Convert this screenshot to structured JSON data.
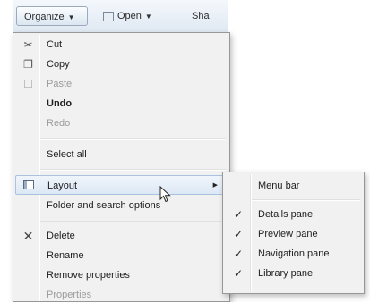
{
  "toolbar": {
    "organize_label": "Organize",
    "open_label": "Open",
    "share_label": "Sha"
  },
  "menu": {
    "items": [
      {
        "label": "Cut",
        "icon": "scissors-icon",
        "state": "enabled"
      },
      {
        "label": "Copy",
        "icon": "copy-icon",
        "state": "enabled"
      },
      {
        "label": "Paste",
        "icon": "paste-icon",
        "state": "disabled"
      },
      {
        "label": "Undo",
        "state": "bold"
      },
      {
        "label": "Redo",
        "state": "disabled"
      },
      {
        "label": "Select all",
        "state": "enabled"
      },
      {
        "label": "Layout",
        "icon": "layout-icon",
        "state": "highlighted",
        "submenu": true
      },
      {
        "label": "Folder and search options",
        "state": "enabled"
      },
      {
        "label": "Delete",
        "icon": "delete-icon",
        "state": "enabled"
      },
      {
        "label": "Rename",
        "state": "enabled"
      },
      {
        "label": "Remove properties",
        "state": "enabled"
      },
      {
        "label": "Properties",
        "state": "disabled"
      }
    ]
  },
  "submenu": {
    "items": [
      {
        "label": "Menu bar",
        "checked": false
      },
      {
        "label": "Details pane",
        "checked": true
      },
      {
        "label": "Preview pane",
        "checked": true
      },
      {
        "label": "Navigation pane",
        "checked": true
      },
      {
        "label": "Library pane",
        "checked": true
      }
    ],
    "check_glyph": "✓"
  },
  "colors": {
    "highlight_border": "#a9c2df",
    "menu_bg": "#f1f1f1",
    "disabled_text": "#9a9a9a"
  }
}
